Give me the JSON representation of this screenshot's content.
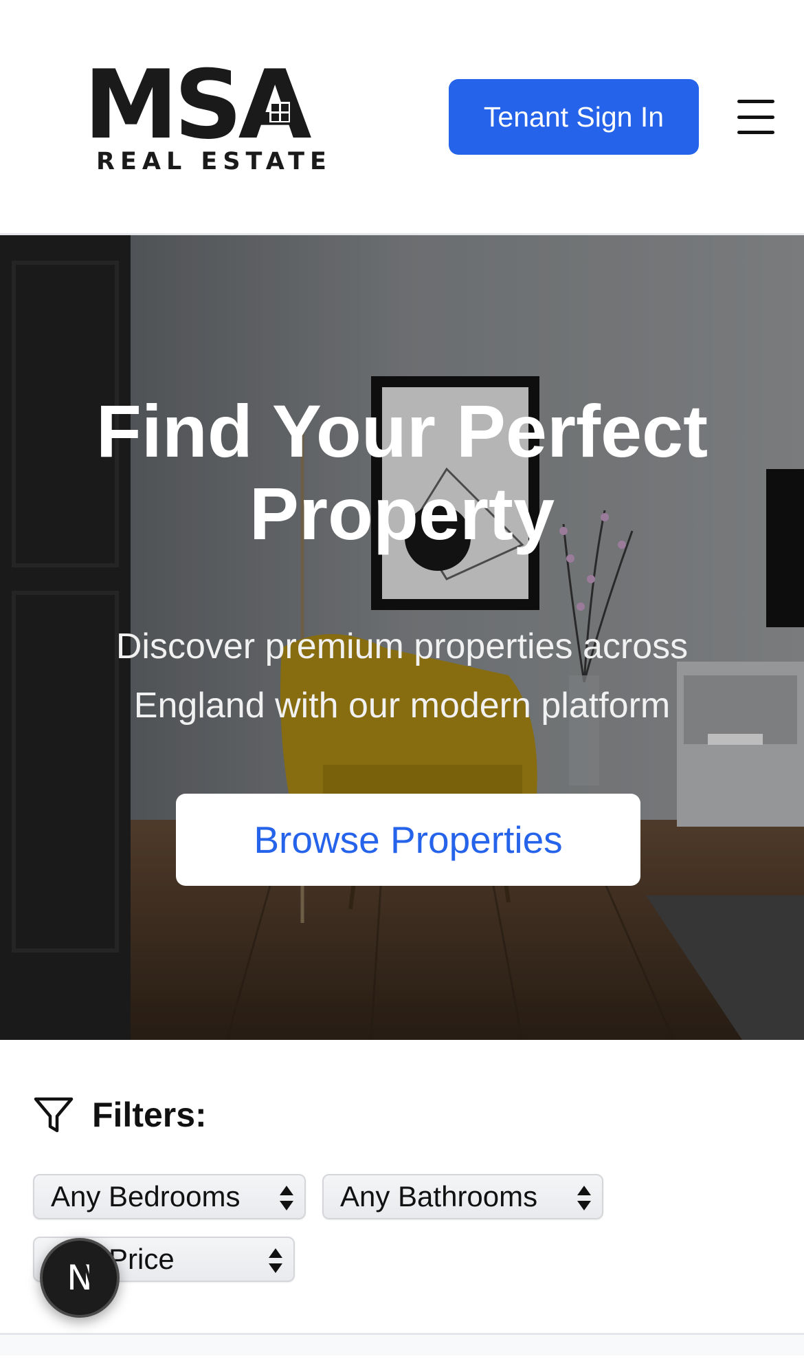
{
  "header": {
    "logo": {
      "primary_text": "MSA",
      "secondary_text": "REAL ESTATE"
    },
    "signin_label": "Tenant Sign In",
    "menu_icon": "hamburger-menu-icon"
  },
  "hero": {
    "title": "Find Your Perfect Property",
    "subtitle": "Discover premium properties across England with our modern platform",
    "cta_label": "Browse Properties"
  },
  "filters": {
    "label": "Filters:",
    "icon": "filter-funnel-icon",
    "bedrooms": {
      "selected": "Any Bedrooms"
    },
    "bathrooms": {
      "selected": "Any Bathrooms"
    },
    "price": {
      "selected": "Any Price"
    }
  },
  "floating_badge": {
    "letter": "N"
  },
  "colors": {
    "accent": "#2563eb",
    "header_bg": "#ffffff",
    "hero_text": "#ffffff",
    "badge_bg": "#1c1c1c"
  }
}
